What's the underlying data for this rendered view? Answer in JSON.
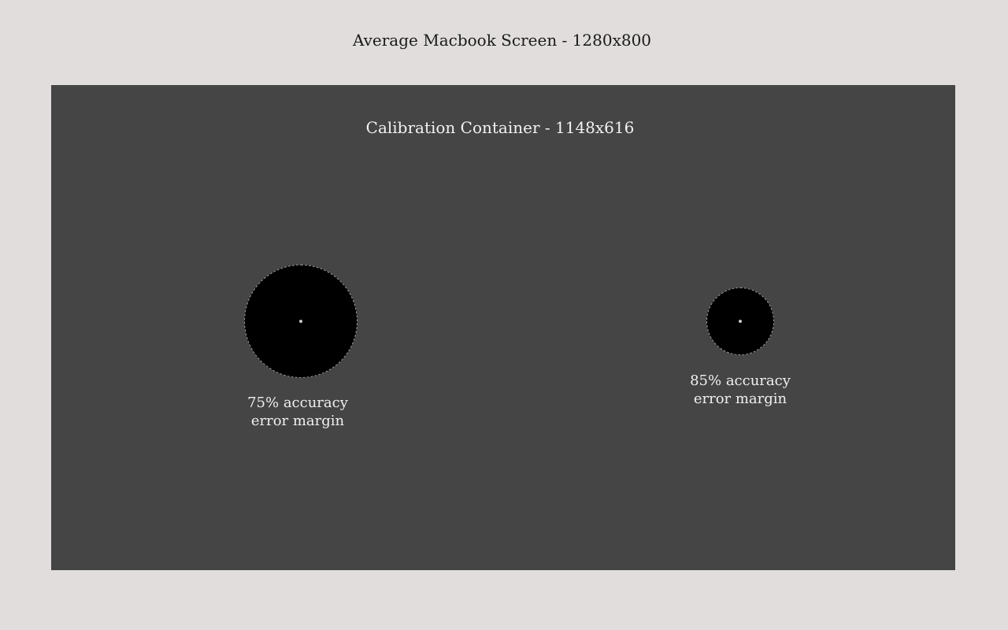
{
  "screen": {
    "title": "Average Macbook Screen - 1280x800"
  },
  "calibration": {
    "title": "Calibration Container - 1148x616",
    "targets": [
      {
        "line1": "75% accuracy",
        "line2": "error margin",
        "icon": "calibration-target-icon"
      },
      {
        "line1": "85% accuracy",
        "line2": "error margin",
        "icon": "calibration-target-icon"
      }
    ]
  },
  "colors": {
    "page_background": "#e0dddc",
    "container_background": "#454545",
    "target_fill": "#000000",
    "target_border": "#9a9a9a",
    "text_light": "#f0f0f0",
    "text_dark": "#1a1a1a"
  }
}
